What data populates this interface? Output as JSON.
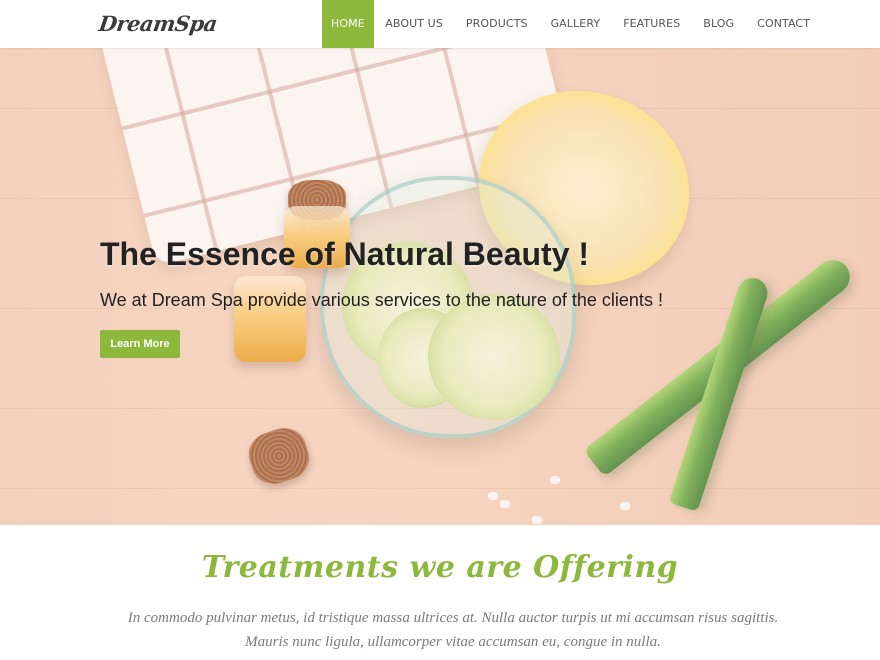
{
  "header": {
    "logo": "DreamSpa",
    "nav": [
      {
        "label": "HOME",
        "active": true
      },
      {
        "label": "ABOUT US",
        "active": false
      },
      {
        "label": "PRODUCTS",
        "active": false
      },
      {
        "label": "GALLERY",
        "active": false
      },
      {
        "label": "FEATURES",
        "active": false
      },
      {
        "label": "BLOG",
        "active": false
      },
      {
        "label": "CONTACT",
        "active": false
      }
    ]
  },
  "hero": {
    "title": "The Essence of Natural Beauty !",
    "subtitle": "We at Dream Spa provide various services to the nature of the clients !",
    "button_label": "Learn More"
  },
  "section": {
    "title": "Treatments we are Offering",
    "text": "In commodo pulvinar metus, id tristique massa ultrices at. Nulla auctor turpis ut mi accumsan risus sagittis. Mauris nunc ligula, ullamcorper vitae accumsan eu, congue in nulla."
  },
  "colors": {
    "accent": "#8cb83c",
    "nav_text": "#555555",
    "body_text": "#7a7a7a"
  }
}
